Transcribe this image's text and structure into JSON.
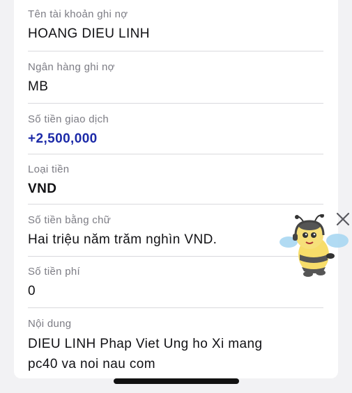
{
  "fields": [
    {
      "label": "Tên tài khoản ghi nợ",
      "value": "HOANG DIEU LINH"
    },
    {
      "label": "Ngân hàng ghi nợ",
      "value": "MB"
    },
    {
      "label": "Số tiền giao dịch",
      "value": "+2,500,000"
    },
    {
      "label": "Loại tiền",
      "value": "VND"
    },
    {
      "label": "Số tiền bằng chữ",
      "value": "Hai triệu năm trăm nghìn VND."
    },
    {
      "label": "Số tiền phí",
      "value": "0"
    },
    {
      "label": "Nội dung",
      "value_lines": [
        "DIEU LINH Phap Viet Ung ho Xi mang",
        "pc40 va noi nau com"
      ]
    }
  ],
  "floating": {
    "close_icon": "close-icon",
    "mascot": "bee-mascot"
  },
  "colors": {
    "amount": "#1c2aa8",
    "label": "#7c7c84",
    "divider": "#d9d9dd"
  }
}
